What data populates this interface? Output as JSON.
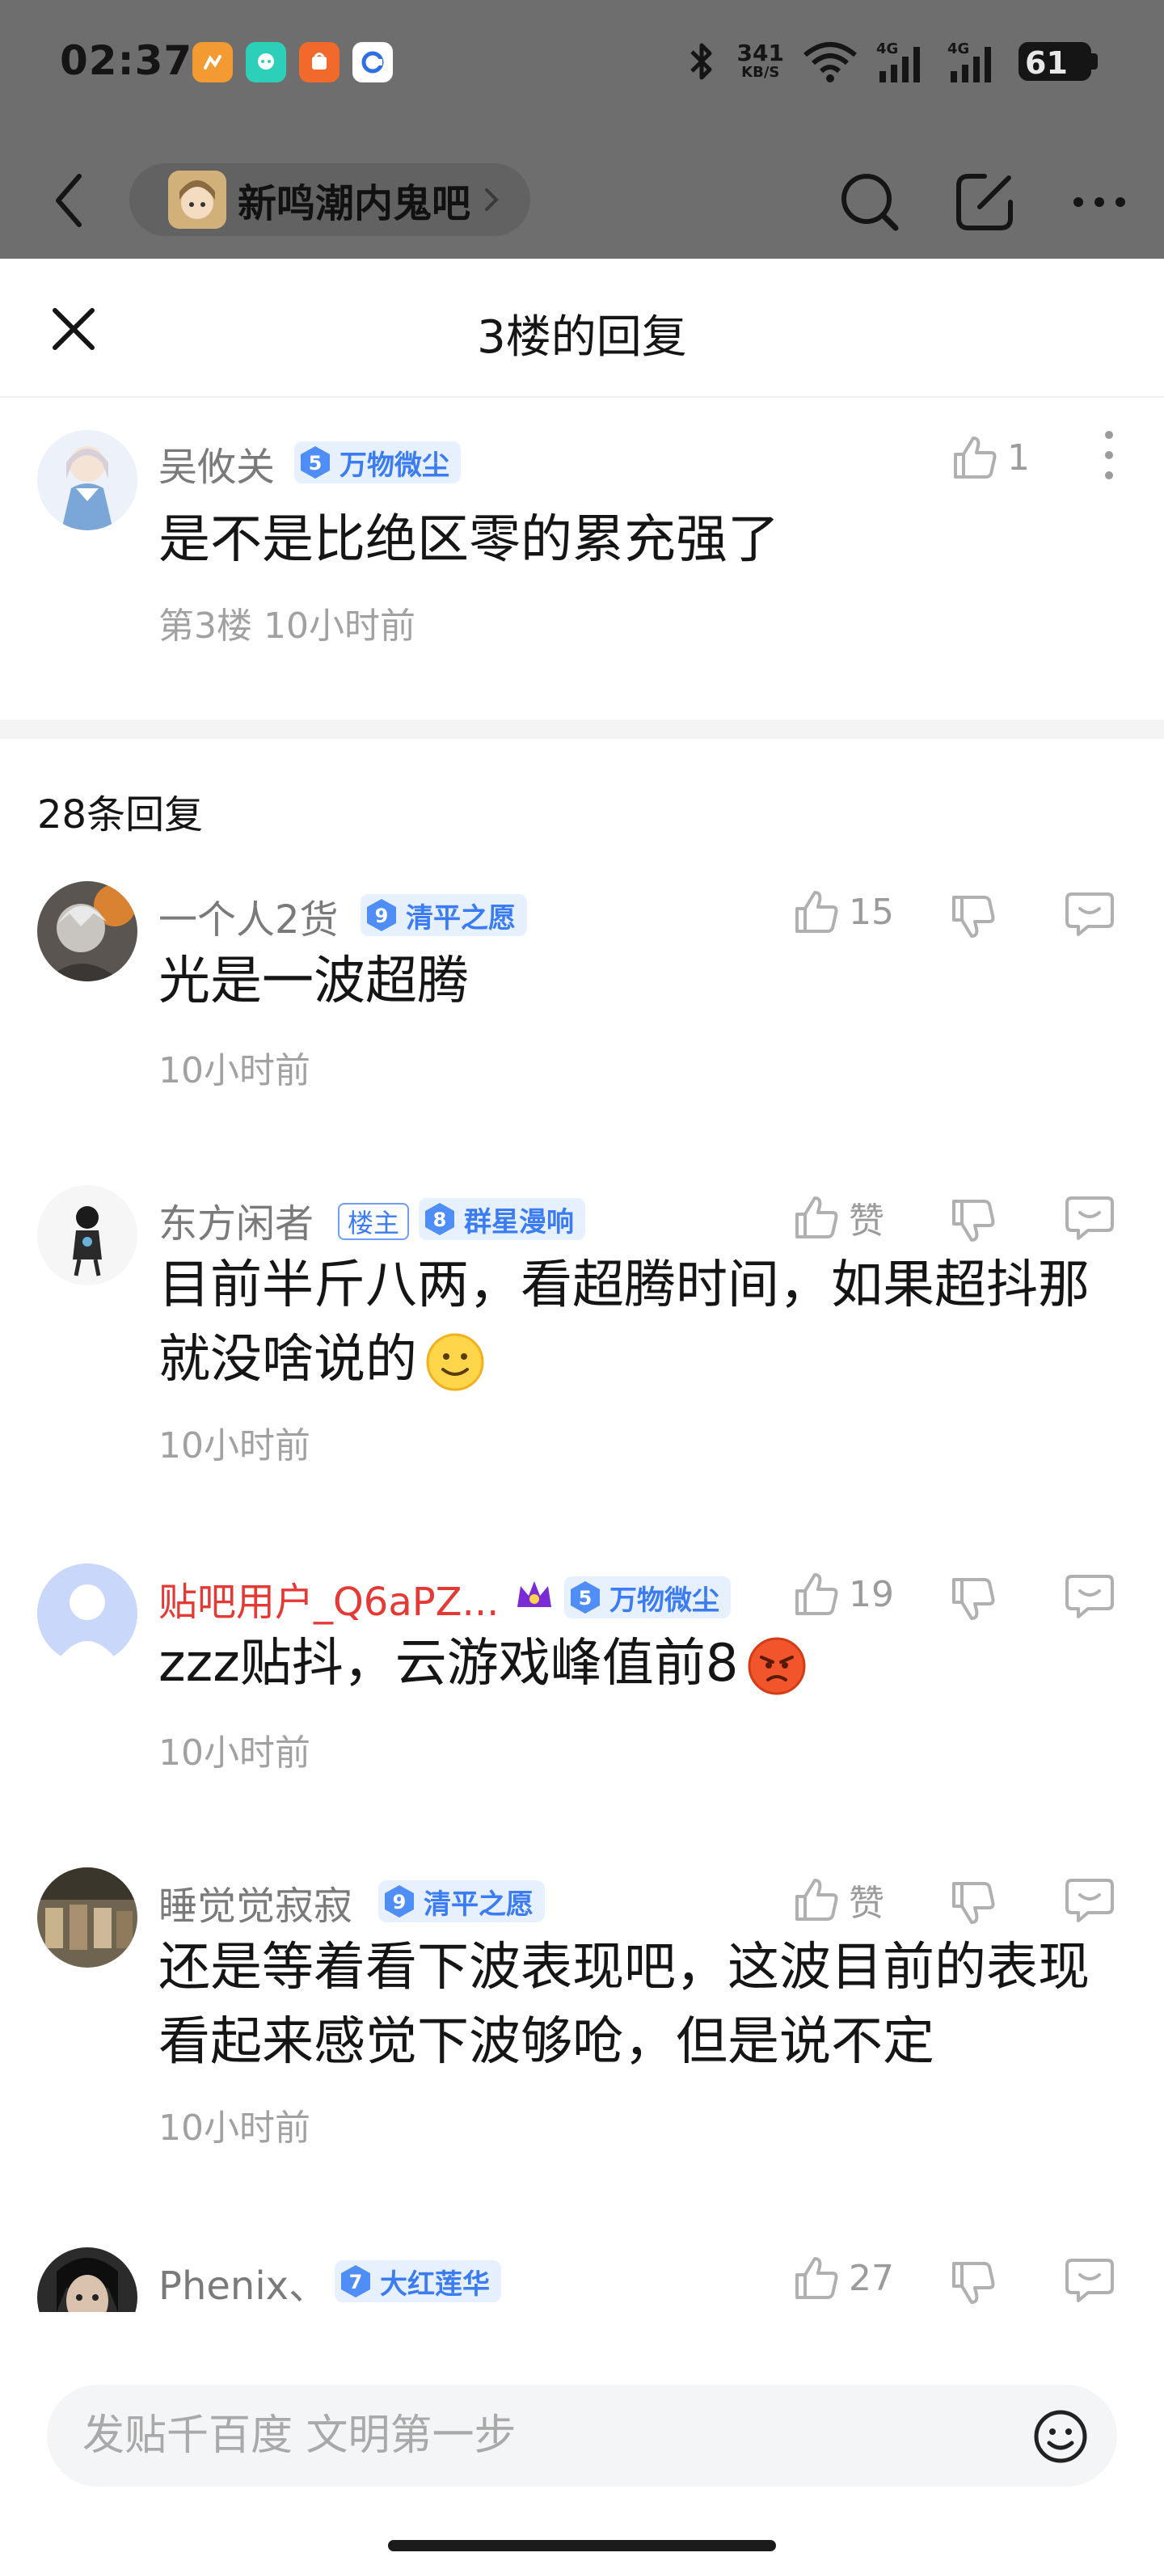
{
  "status_bar": {
    "time": "02:37",
    "net_speed_value": "341",
    "net_speed_unit": "KB/S",
    "battery": "61"
  },
  "nav": {
    "forum_name": "新鸣潮内鬼吧"
  },
  "sheet": {
    "title": "3楼的回复"
  },
  "op": {
    "username": "吴攸关",
    "level": "5",
    "level_title": "万物微尘",
    "likes": "1",
    "content": "是不是比绝区零的累充强了",
    "meta": "第3楼 10小时前"
  },
  "reply_count_label": "28条回复",
  "replies": [
    {
      "username": "一个人2货",
      "level": "9",
      "level_title": "清平之愿",
      "likes": "15",
      "content": "光是一波超腾",
      "time": "10小时前"
    },
    {
      "username": "东方闲者",
      "host_tag": "楼主",
      "level": "8",
      "level_title": "群星漫响",
      "likes": "赞",
      "content": "目前半斤八两，看超腾时间，如果超抖那就没啥说的",
      "time": "10小时前"
    },
    {
      "username": "贴吧用户_Q6aPZ...",
      "level": "5",
      "level_title": "万物微尘",
      "likes": "19",
      "content": "zzz贴抖，云游戏峰值前8",
      "time": "10小时前"
    },
    {
      "username": "睡觉觉寂寂",
      "level": "9",
      "level_title": "清平之愿",
      "likes": "赞",
      "content": "还是等着看下波表现吧，这波目前的表现看起来感觉下波够呛，但是说不定",
      "time": "10小时前"
    },
    {
      "username": "Phenix、",
      "level": "7",
      "level_title": "大红莲华",
      "likes": "27"
    }
  ],
  "input": {
    "placeholder": "发贴千百度 文明第一步"
  },
  "colors": {
    "accent": "#3b7cf5",
    "badge_bg": "#e6f0ff",
    "dim_overlay": "#6e6e6e",
    "red_name": "#e53935"
  }
}
